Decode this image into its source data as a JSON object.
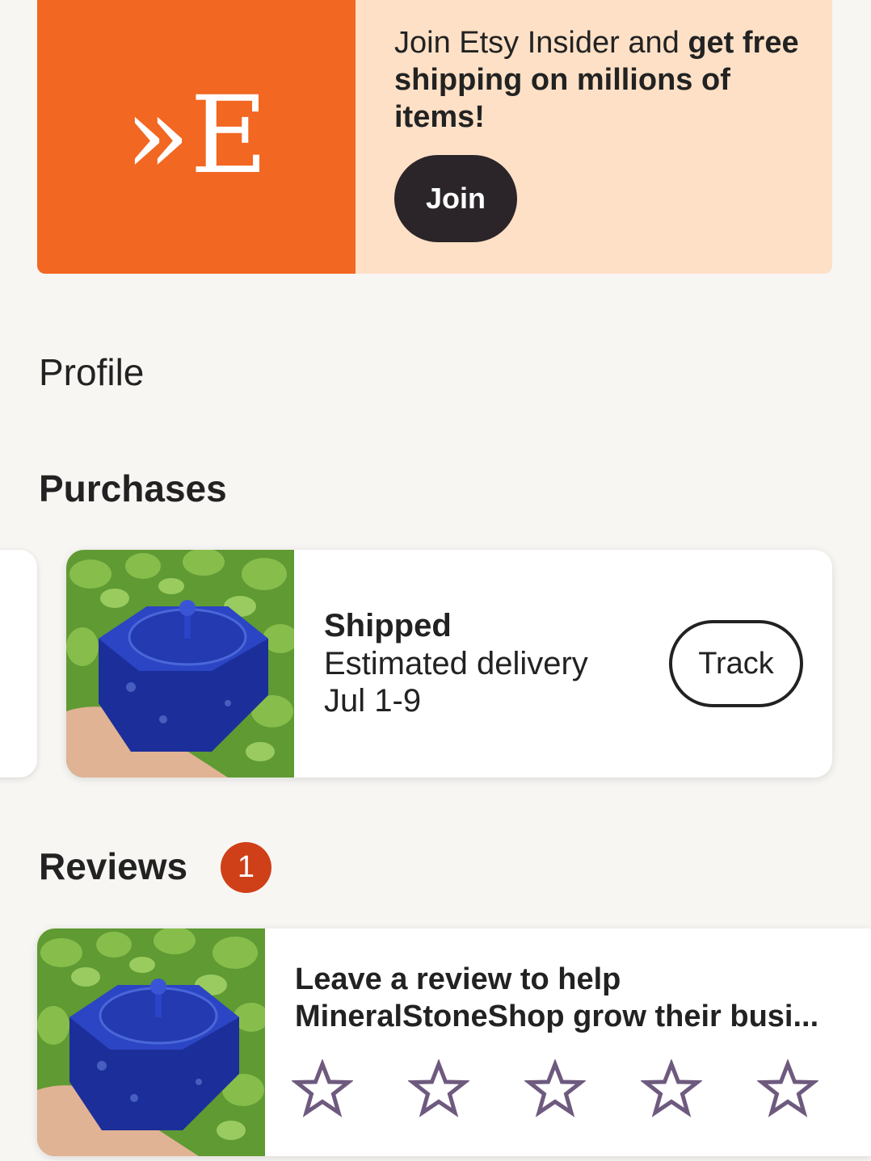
{
  "banner": {
    "logo": "»E",
    "text_regular": "Join Etsy Insider and ",
    "text_bold": "get free shipping on millions of items!",
    "join_label": "Join",
    "colors": {
      "logo_bg": "#f26722",
      "banner_bg": "#fde0c6",
      "button_bg": "#2b2529"
    }
  },
  "profile": {
    "label": "Profile"
  },
  "purchases": {
    "title": "Purchases",
    "card": {
      "status": "Shipped",
      "delivery_label": "Estimated delivery",
      "delivery_date": "Jul 1-9",
      "track_label": "Track"
    }
  },
  "reviews": {
    "title": "Reviews",
    "badge_count": "1",
    "badge_color": "#cf4018",
    "card": {
      "prompt": "Leave a review to help MineralStoneShop grow their busi...",
      "star_count": 5,
      "star_icon": "star-outline-icon",
      "star_color": "#6e5a7e"
    }
  }
}
